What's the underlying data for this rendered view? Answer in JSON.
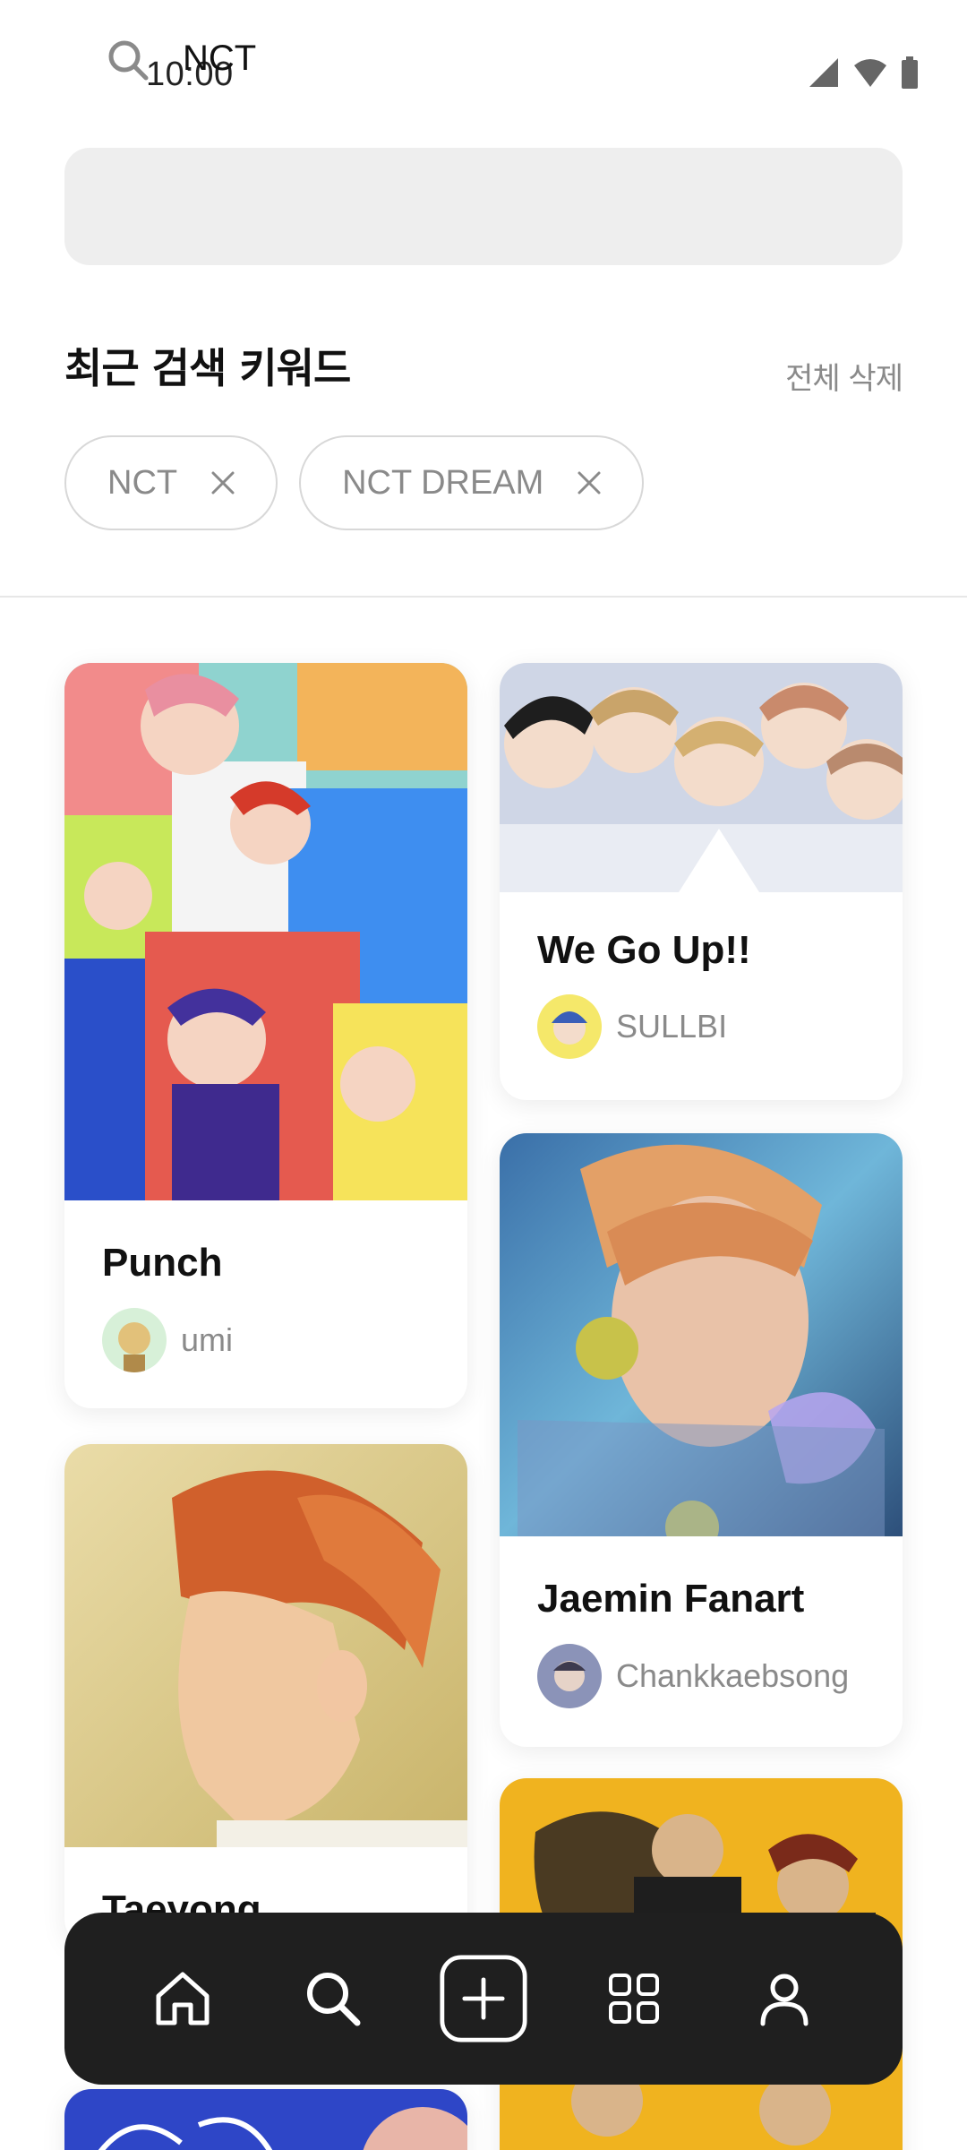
{
  "status_bar": {
    "time": "10:00"
  },
  "search": {
    "query": "NCT"
  },
  "recent": {
    "title": "최근 검색 키워드",
    "clear_all": "전체 삭제",
    "keywords": [
      "NCT",
      "NCT DREAM"
    ]
  },
  "cards": [
    {
      "title": "Punch",
      "author": "umi"
    },
    {
      "title": "We Go Up!!",
      "author": "SULLBI"
    },
    {
      "title": "Jaemin Fanart",
      "author": "Chankkaebsong"
    },
    {
      "title": "Taeyong",
      "author": ""
    }
  ],
  "nav": {
    "icons": [
      "home-icon",
      "search-icon",
      "add-icon",
      "grid-icon",
      "profile-icon"
    ]
  }
}
